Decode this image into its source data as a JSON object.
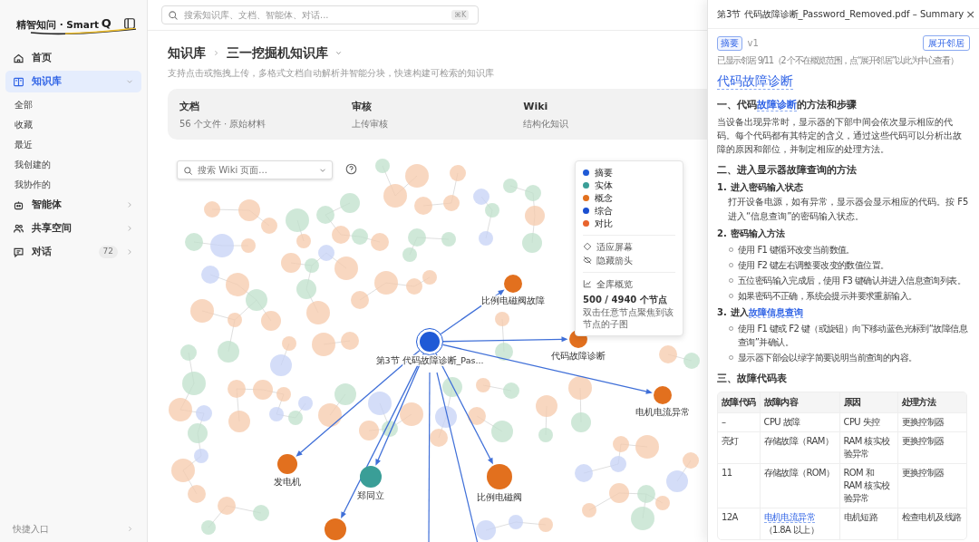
{
  "sidebar": {
    "logo_text": "精智知问 · Smart",
    "logo_mark": "Q",
    "nav": [
      {
        "kind": "link",
        "label": "首页",
        "selected": false
      },
      {
        "kind": "group",
        "label": "知识库",
        "selected": true,
        "expanded": true,
        "children": [
          {
            "label": "全部",
            "selected": false
          },
          {
            "label": "收藏",
            "selected": false
          },
          {
            "label": "最近",
            "selected": false
          },
          {
            "label": "我创建的",
            "selected": false
          },
          {
            "label": "我协作的",
            "selected": false
          }
        ]
      },
      {
        "kind": "group",
        "label": "智能体",
        "selected": false,
        "expanded": false
      },
      {
        "kind": "group",
        "label": "共享空间",
        "selected": false,
        "expanded": false
      },
      {
        "kind": "group",
        "label": "对话",
        "selected": false,
        "expanded": false,
        "badge": "72"
      }
    ],
    "footer": "快捷入口"
  },
  "topbar": {
    "search_placeholder": "搜索知识库、文档、智能体、对话...",
    "shortcut": "⌘K"
  },
  "main": {
    "breadcrumb": [
      "知识库",
      "三一挖掘机知识库"
    ],
    "subtitle": "支持点击或拖拽上传，多格式文档自动解析并智能分块，快速构建可检索的知识库",
    "tiles": [
      {
        "title": "文档",
        "subtitle": "56 个文件 · 原始材料"
      },
      {
        "title": "审核",
        "subtitle": "上传审核"
      },
      {
        "title": "Wiki",
        "subtitle": "结构化知识"
      }
    ],
    "graph": {
      "search_placeholder": "搜索 Wiki 页面...",
      "legend": [
        {
          "label": "摘要",
          "color": "#1f5ad6"
        },
        {
          "label": "实体",
          "color": "#3a9e97"
        },
        {
          "label": "概念",
          "color": "#e2701e"
        },
        {
          "label": "综合",
          "color": "#1a4fd0"
        },
        {
          "label": "对比",
          "color": "#e8632c"
        }
      ],
      "actions": [
        {
          "label": "适应屏幕"
        },
        {
          "label": "隐藏箭头"
        }
      ],
      "overview": {
        "label": "全库概览",
        "count": "500 / 4940 个节点",
        "hint": "双击任意节点聚焦到该节点的子图"
      },
      "nodes": [
        {
          "label": "第3节 代码故障诊断_Pas...",
          "color": "#1f5ad6",
          "selected": true
        },
        {
          "label": "比例电磁阀故障",
          "color": "#e2701e",
          "selected": false
        },
        {
          "label": "代码故障诊断",
          "color": "#e2701e",
          "selected": false
        },
        {
          "label": "电机电流异常",
          "color": "#e2701e",
          "selected": false
        },
        {
          "label": "发电机",
          "color": "#e2701e",
          "selected": false
        },
        {
          "label": "郑同立",
          "color": "#3a9e97",
          "selected": false
        },
        {
          "label": "比例电磁阀",
          "color": "#e2701e",
          "selected": false
        },
        {
          "color": "#e2701e",
          "selected": false
        }
      ]
    }
  },
  "panel": {
    "title": "第3节 代码故障诊断_Password_Removed.pdf – Summary",
    "close": "×",
    "tag": "摘要",
    "version": "v1",
    "button": "展开邻居",
    "note": "已显示邻居 9/11（2 个不在概览范围，点“展开邻居”以此为中心查看）",
    "heading": "代码故障诊断",
    "sections": [
      {
        "heading": [
          {
            "text": "一、代码"
          },
          {
            "text": "故障诊断",
            "link": true
          },
          {
            "text": "的方法和步骤"
          }
        ],
        "paragraph": "当设备出现异常时，显示器的下部中间会依次显示相应的代码。每个代码都有其特定的含义，通过这些代码可以分析出故障的原因和部位，并制定相应的处理方法。"
      },
      {
        "heading": [
          {
            "text": "二、进入显示器故障查询的方法"
          }
        ],
        "steps": [
          {
            "number": "1.",
            "title": [
              {
                "text": "进入密码输入状态"
              }
            ],
            "text": "打开设备电源，如有异常，显示器会显示相应的代码。按 F5 进入“信息查询”的密码输入状态。"
          },
          {
            "number": "2.",
            "title": [
              {
                "text": "密码输入方法"
              }
            ],
            "bullets": [
              "使用 F1 键循环改变当前数值。",
              "使用 F2 键左右调整要改变的数值位置。",
              "五位密码输入完成后，使用 F3 键确认并进入信息查询列表。",
              "如果密码不正确，系统会提示并要求重新输入。"
            ]
          },
          {
            "number": "3.",
            "title": [
              {
                "text": "进入"
              },
              {
                "text": "故障信息查询",
                "link": true
              }
            ],
            "bullets": [
              "使用 F1 键或 F2 键（或旋钮）向下移动蓝色光标到“故障信息查询”并确认。",
              "显示器下部会以绿字简要说明当前查询的内容。"
            ]
          }
        ]
      },
      {
        "heading": [
          {
            "text": "三、故障代码表"
          }
        ],
        "table": {
          "columns": [
            "故障代码",
            "故障内容",
            "原因",
            "处理方法"
          ],
          "rows": [
            [
              "–",
              "CPU 故障",
              "CPU 失控",
              "更换控制器"
            ],
            [
              "亮灯",
              "存储故障（RAM）",
              "RAM 核实校验异常",
              "更换控制器"
            ],
            [
              "11",
              "存储故障（ROM）",
              "ROM 和 RAM 核实校验异常",
              "更换控制器"
            ],
            [
              "12A",
              {
                "link": "电机电流异常",
                "text": "（1.8A 以上）"
              },
              "电机短路",
              "检查电机及线路"
            ]
          ]
        }
      }
    ]
  }
}
